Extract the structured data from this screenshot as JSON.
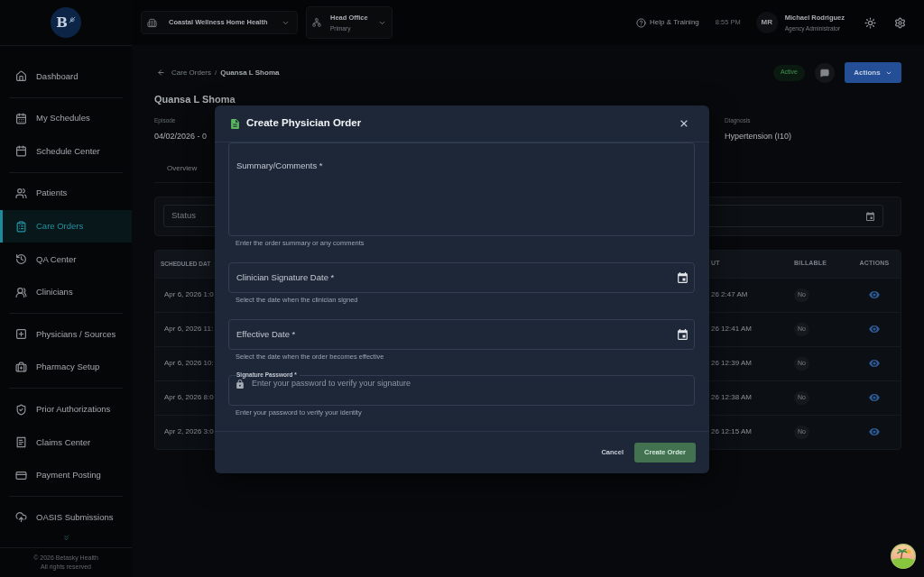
{
  "sidebar": {
    "logo": {
      "letter": "B"
    },
    "groups": [
      {
        "items": [
          {
            "label": "Dashboard",
            "selected": false
          }
        ]
      },
      {
        "items": [
          {
            "label": "My Schedules",
            "selected": false
          },
          {
            "label": "Schedule Center",
            "selected": false
          }
        ]
      },
      {
        "items": [
          {
            "label": "Patients",
            "selected": false
          },
          {
            "label": "Care Orders",
            "selected": true
          },
          {
            "label": "QA Center",
            "selected": false
          },
          {
            "label": "Clinicians",
            "selected": false
          }
        ]
      },
      {
        "items": [
          {
            "label": "Physicians / Sources",
            "selected": false
          },
          {
            "label": "Pharmacy Setup",
            "selected": false
          }
        ]
      },
      {
        "items": [
          {
            "label": "Prior Authorizations",
            "selected": false
          },
          {
            "label": "Claims Center",
            "selected": false
          },
          {
            "label": "Payment Posting",
            "selected": false
          }
        ]
      },
      {
        "items": [
          {
            "label": "OASIS Submissions",
            "selected": false
          }
        ]
      }
    ],
    "footer": [
      "© 2026 Betasky Health",
      "All rights reserved"
    ]
  },
  "top_bar": {
    "organization": "Coastal Wellness Home Health",
    "office": {
      "name": "Head Office",
      "type": "Primary"
    },
    "help": "Help & Training",
    "time": "8:55 PM",
    "user": {
      "initials": "MR",
      "name": "Michael Rodriguez",
      "role": "Agency Administrator"
    }
  },
  "page": {
    "breadcrumb": [
      "Care Orders",
      "Quansa L Shoma"
    ],
    "separator": "/",
    "status": "Active",
    "actions": "Actions",
    "title": "Quansa L Shoma",
    "details": [
      {
        "label": "Episode",
        "value": "04/02/2026 - 0"
      },
      {
        "label": "Diagnosis",
        "value": "Hypertension (I10)"
      }
    ],
    "tabs": [
      {
        "label": "Overview",
        "selected": false
      }
    ],
    "filters": {
      "status": {
        "placeholder": "Status"
      }
    },
    "table": {
      "columns": [
        "SCHEDULED DAT",
        "UT",
        "BILLABLE",
        "ACTIONS"
      ],
      "rows": [
        {
          "cells": [
            "Apr 6, 2026 1:0",
            "26 2:47 AM",
            "No"
          ]
        },
        {
          "cells": [
            "Apr 6, 2026 11:",
            "26 12:41 AM",
            "No"
          ]
        },
        {
          "cells": [
            "Apr 6, 2026 10:",
            "26 12:39 AM",
            "No"
          ]
        },
        {
          "cells": [
            "Apr 6, 2026 8:0",
            "26 12:38 AM",
            "No"
          ]
        },
        {
          "cells": [
            "Apr 2, 2026 3:0",
            "26 12:15 AM",
            "No"
          ]
        }
      ]
    }
  },
  "dialog": {
    "title": "Create Physician Order",
    "fields": [
      {
        "kind": "textarea",
        "label": "Summary/Comments *",
        "helper": "Enter the order summary or any comments"
      },
      {
        "kind": "date",
        "label": "Clinician Signature Date *",
        "helper": "Select the date when the clinician signed"
      },
      {
        "kind": "date",
        "label": "Effective Date *",
        "helper": "Select the date when the order becomes effective"
      },
      {
        "kind": "password",
        "label": "Signature Password *",
        "placeholder": "Enter your password to verify your signature",
        "helper": "Enter your password to verify your identity"
      }
    ],
    "buttons": [
      {
        "kind": "text",
        "label": "Cancel",
        "disabled": false
      },
      {
        "kind": "primary",
        "label": "Create Order",
        "disabled": true
      }
    ]
  }
}
